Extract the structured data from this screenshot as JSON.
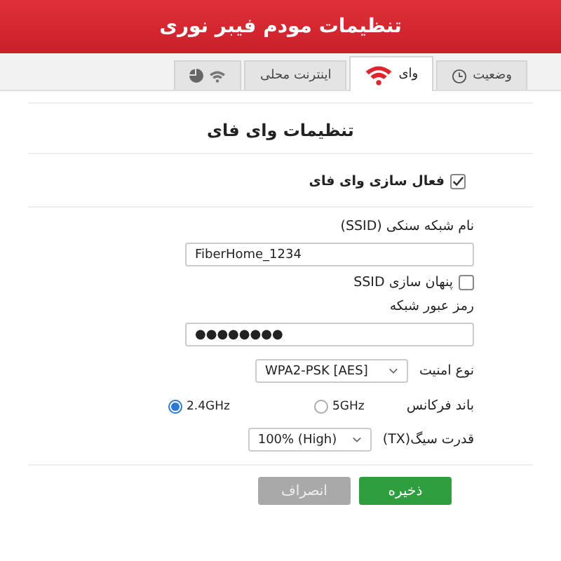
{
  "header": {
    "title": "تنظیمات مودم فیبر نوری"
  },
  "tabs": [
    {
      "kind": "status",
      "label": "وضعیت",
      "selected": false
    },
    {
      "kind": "wifi",
      "label": "وای",
      "selected": true
    },
    {
      "kind": "text",
      "label": "اینترنت محلی",
      "selected": false
    },
    {
      "kind": "icons",
      "selected": false
    }
  ],
  "section_title": "تنظیمات وای فای",
  "enable_wifi": {
    "label": "فعال سازی وای فای",
    "checked": true
  },
  "ssid": {
    "label": "نام شبکه سنکی (SSID)",
    "value": "FiberHome_1234"
  },
  "hide_ssid": {
    "label": "پنهان سازی SSID",
    "checked": false
  },
  "password": {
    "label": "رمز عبور شبکه",
    "value": "●●●●●●●●"
  },
  "security": {
    "label": "نوع امنیت",
    "value": "WPA2-PSK [AES]"
  },
  "band": {
    "label": "باند فرکانس",
    "options": [
      {
        "label": "5GHz",
        "selected": false
      },
      {
        "label": "2.4GHz",
        "selected": true
      }
    ]
  },
  "tx_power": {
    "label": "قدرت سیگ(TX)",
    "value": "100% (High)"
  },
  "buttons": [
    {
      "kind": "primary",
      "label": "ذخیره"
    },
    {
      "kind": "secondary",
      "label": "انصراف"
    }
  ]
}
